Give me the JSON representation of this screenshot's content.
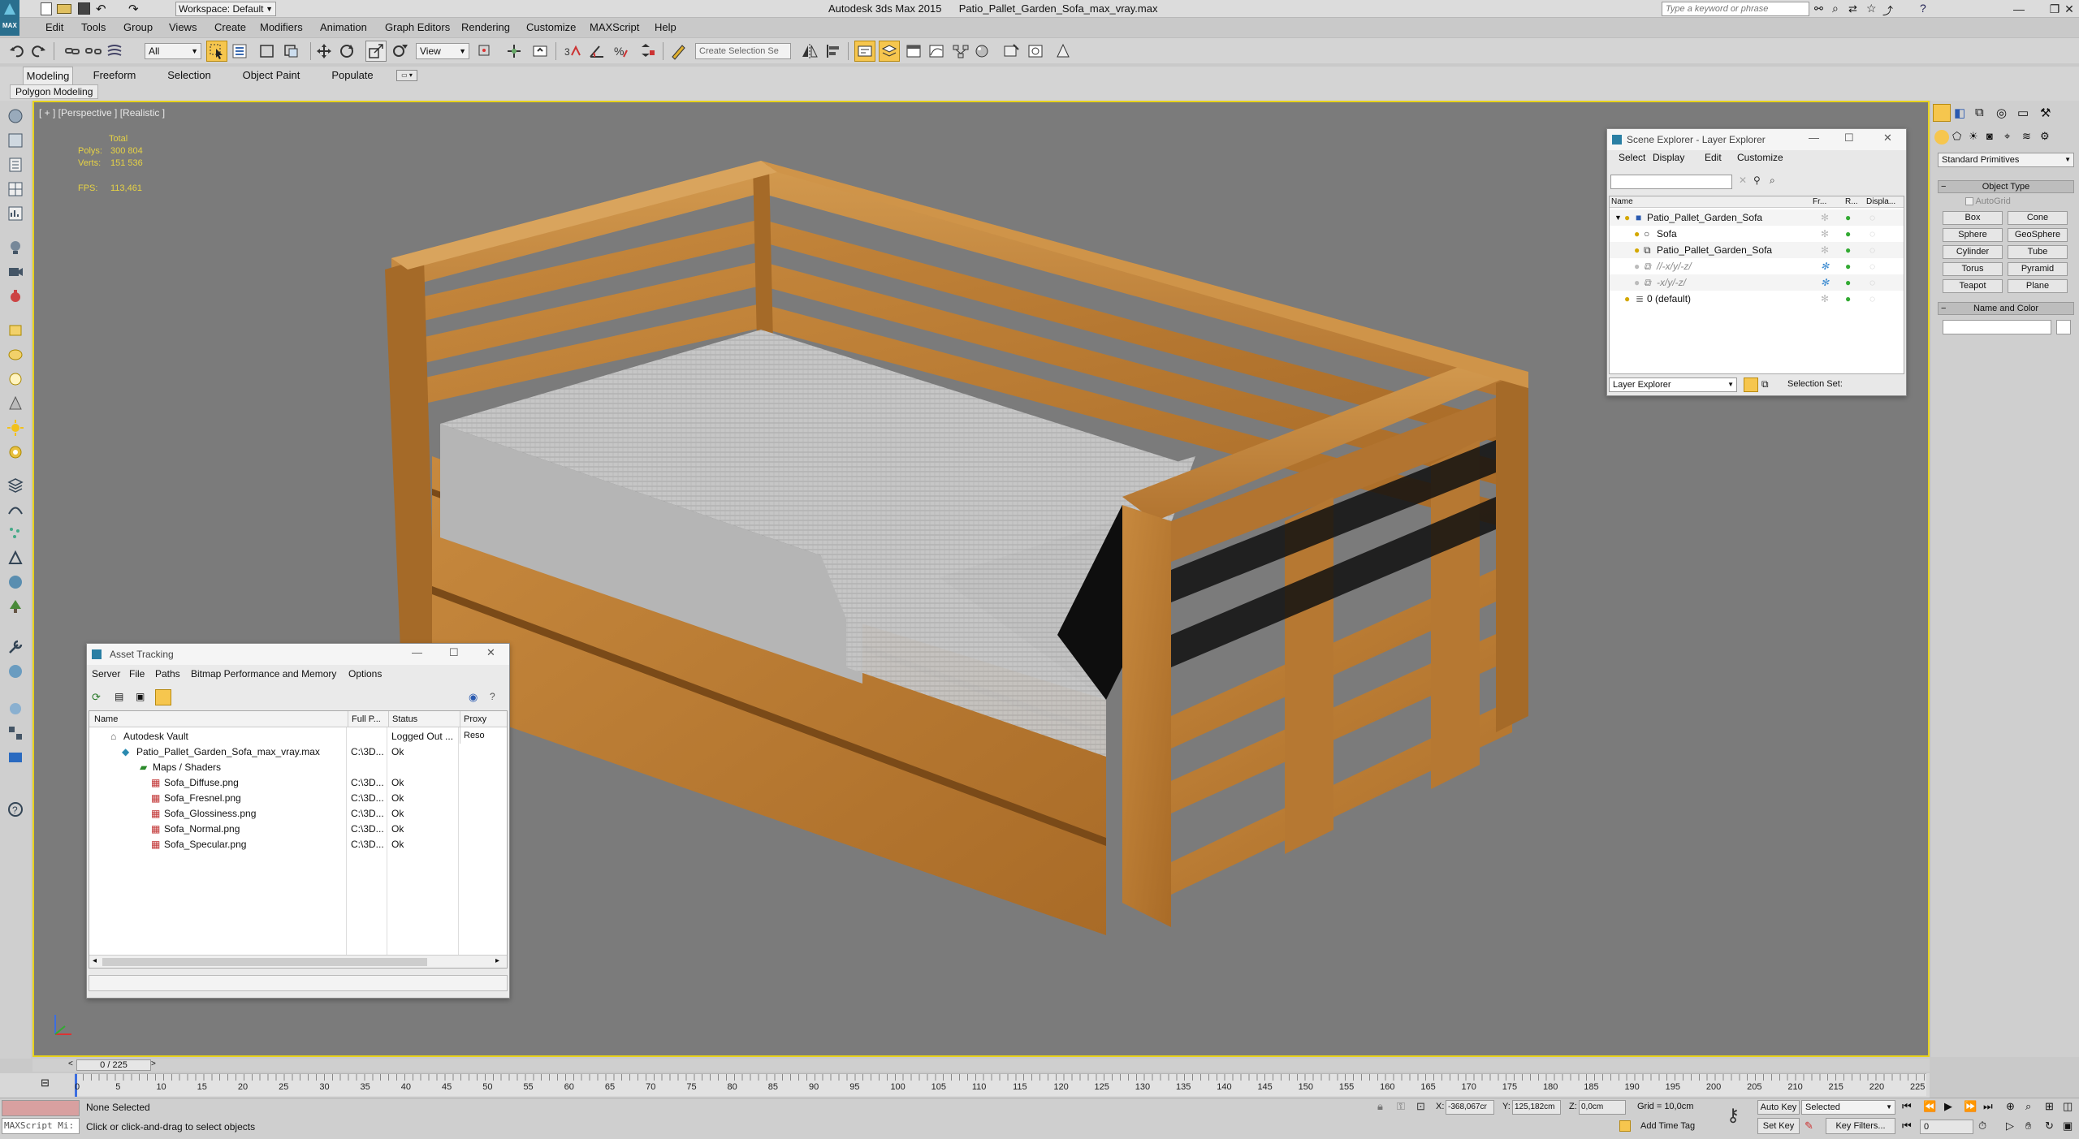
{
  "titlebar": {
    "app_title": "Autodesk 3ds Max  2015",
    "file_title": "Patio_Pallet_Garden_Sofa_max_vray.max",
    "workspace_label": "Workspace: Default",
    "search_placeholder": "Type a keyword or phrase"
  },
  "menubar": {
    "items": [
      "Edit",
      "Tools",
      "Group",
      "Views",
      "Create",
      "Modifiers",
      "Animation",
      "Graph Editors",
      "Rendering",
      "Customize",
      "MAXScript",
      "Help"
    ]
  },
  "toolbar": {
    "filter_value": "All",
    "refcoord_value": "View",
    "selection_set_placeholder": "Create Selection Se"
  },
  "ribbon": {
    "tabs": [
      "Modeling",
      "Freeform",
      "Selection",
      "Object Paint",
      "Populate"
    ],
    "active_tab": "Modeling",
    "subpanel": "Polygon Modeling"
  },
  "viewport": {
    "label": "[ + ] [Perspective ] [Realistic ]",
    "stats_total": "Total",
    "polys_label": "Polys:",
    "polys_value": "300 804",
    "verts_label": "Verts:",
    "verts_value": "151 536",
    "fps_label": "FPS:",
    "fps_value": "113,461",
    "bg_color": "#7b7b7b",
    "border_color": "#e8d21c"
  },
  "scene_explorer": {
    "title": "Scene Explorer - Layer Explorer",
    "menu": [
      "Select",
      "Display",
      "Edit",
      "Customize"
    ],
    "columns": [
      "Name",
      "Fr...",
      "R...",
      "Displa..."
    ],
    "rows": [
      {
        "name": "Patio_Pallet_Garden_Sofa",
        "indent": 0
      },
      {
        "name": "Sofa",
        "indent": 1
      },
      {
        "name": "Patio_Pallet_Garden_Sofa",
        "indent": 1
      },
      {
        "name": "//-x/y/-z/",
        "indent": 1
      },
      {
        "name": "-x/y/-z/",
        "indent": 1
      },
      {
        "name": "0 (default)",
        "indent": 0
      }
    ],
    "footer_select": "Layer Explorer",
    "footer_label": "Selection Set:"
  },
  "asset_tracking": {
    "title": "Asset Tracking",
    "menu": [
      "Server",
      "File",
      "Paths",
      "Bitmap Performance and Memory",
      "Options"
    ],
    "columns": [
      "Name",
      "Full P...",
      "Status",
      "Proxy Reso"
    ],
    "rows": [
      {
        "name": "Autodesk Vault",
        "path": "",
        "status": "Logged Out ...",
        "indent": 0
      },
      {
        "name": "Patio_Pallet_Garden_Sofa_max_vray.max",
        "path": "C:\\3D...",
        "status": "Ok",
        "indent": 1
      },
      {
        "name": "Maps / Shaders",
        "path": "",
        "status": "",
        "indent": 2
      },
      {
        "name": "Sofa_Diffuse.png",
        "path": "C:\\3D...",
        "status": "Ok",
        "indent": 3
      },
      {
        "name": "Sofa_Fresnel.png",
        "path": "C:\\3D...",
        "status": "Ok",
        "indent": 3
      },
      {
        "name": "Sofa_Glossiness.png",
        "path": "C:\\3D...",
        "status": "Ok",
        "indent": 3
      },
      {
        "name": "Sofa_Normal.png",
        "path": "C:\\3D...",
        "status": "Ok",
        "indent": 3
      },
      {
        "name": "Sofa_Specular.png",
        "path": "C:\\3D...",
        "status": "Ok",
        "indent": 3
      }
    ]
  },
  "command_panel": {
    "category": "Standard Primitives",
    "object_type_header": "Object Type",
    "autogrid": "AutoGrid",
    "buttons": [
      "Box",
      "Cone",
      "Sphere",
      "GeoSphere",
      "Cylinder",
      "Tube",
      "Torus",
      "Pyramid",
      "Teapot",
      "Plane"
    ],
    "name_color_header": "Name and Color"
  },
  "timeline": {
    "frame_counter": "0 / 225",
    "ticks": [
      "0",
      "5",
      "10",
      "15",
      "20",
      "25",
      "30",
      "35",
      "40",
      "45",
      "50",
      "55",
      "60",
      "65",
      "70",
      "75",
      "80",
      "85",
      "90",
      "95",
      "100",
      "105",
      "110",
      "115",
      "120",
      "125",
      "130",
      "135",
      "140",
      "145",
      "150",
      "155",
      "160",
      "165",
      "170",
      "175",
      "180",
      "185",
      "190",
      "195",
      "200",
      "205",
      "210",
      "215",
      "220",
      "225"
    ]
  },
  "statusbar": {
    "maxscript_label": "MAXScript Mi:",
    "selection_text": "None Selected",
    "prompt_text": "Click or click-and-drag to select objects",
    "x_label": "X:",
    "x_value": "-368,067cr",
    "y_label": "Y:",
    "y_value": "125,182cm",
    "z_label": "Z:",
    "z_value": "0,0cm",
    "grid_text": "Grid = 10,0cm",
    "add_time_tag": "Add Time Tag",
    "auto_key": "Auto Key",
    "set_key": "Set Key",
    "selected_value": "Selected",
    "key_filters": "Key Filters...",
    "frame_value": "0"
  }
}
